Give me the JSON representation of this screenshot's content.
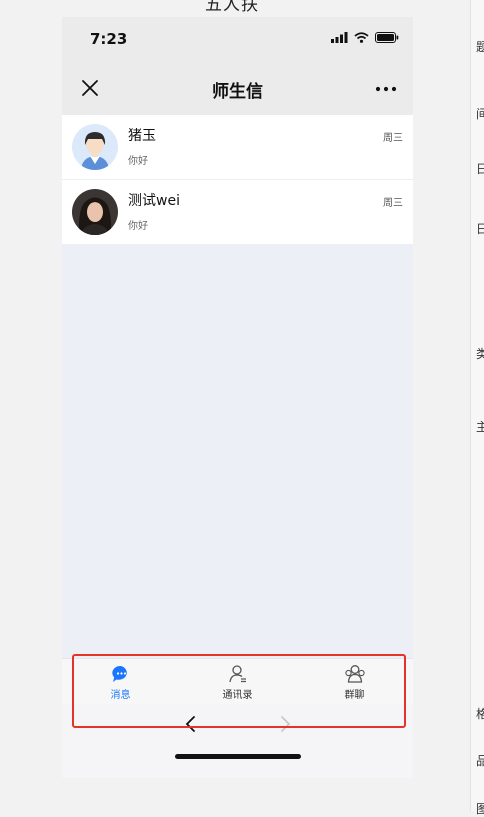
{
  "page_title_cut": "五人扶",
  "right_panel_fragments": [
    "题",
    "间",
    "日",
    "日",
    "类",
    "主",
    "格",
    "品",
    "图"
  ],
  "status": {
    "time": "7:23"
  },
  "header": {
    "title": "师生信",
    "close_icon": "close-icon",
    "more_icon": "more-icon"
  },
  "conversations": [
    {
      "name": "猪玉",
      "preview": "你好",
      "time": "周三",
      "avatar": "cartoon-avatar"
    },
    {
      "name": "测试wei",
      "preview": "你好",
      "time": "周三",
      "avatar": "photo-avatar"
    }
  ],
  "tabs": [
    {
      "label": "消息",
      "icon": "chat-bubble-icon",
      "active": true
    },
    {
      "label": "通讯录",
      "icon": "contact-icon",
      "active": false
    },
    {
      "label": "群聊",
      "icon": "group-icon",
      "active": false
    }
  ],
  "colors": {
    "accent": "#1a76ff",
    "tab_inactive": "#333333",
    "highlight": "#e5332a"
  }
}
